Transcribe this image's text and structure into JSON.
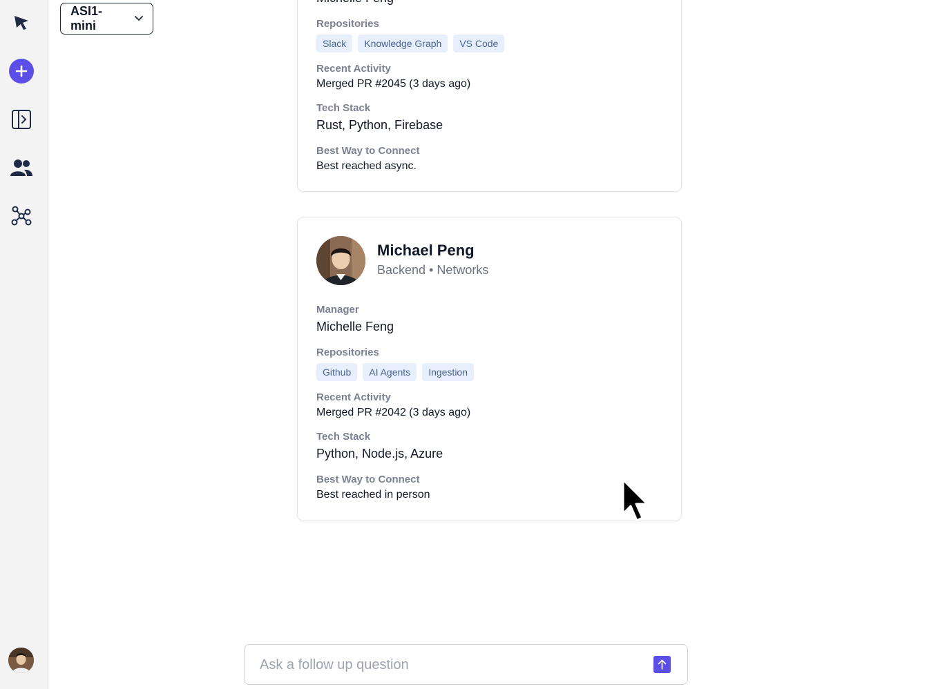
{
  "sidebar": {
    "icons": [
      "logo-arrow-icon",
      "new-chat-icon",
      "toggle-panel-icon",
      "people-icon",
      "graph-icon"
    ],
    "accent": "#5b4fe8"
  },
  "model_selector": {
    "label": "ASI1-mini"
  },
  "cards": {
    "top": {
      "manager_name_cut": "Michelle Feng",
      "repositories_label": "Repositories",
      "repositories": [
        "Slack",
        "Knowledge Graph",
        "VS Code"
      ],
      "recent_activity_label": "Recent Activity",
      "recent_activity": "Merged PR #2045 (3 days ago)",
      "tech_stack_label": "Tech Stack",
      "tech_stack": "Rust, Python, Firebase",
      "connect_label": "Best Way to Connect",
      "connect": "Best reached async."
    },
    "bottom": {
      "name": "Michael Peng",
      "role": "Backend • Networks",
      "manager_label": "Manager",
      "manager": "Michelle Feng",
      "repositories_label": "Repositories",
      "repositories": [
        "Github",
        "AI Agents",
        "Ingestion"
      ],
      "recent_activity_label": "Recent Activity",
      "recent_activity": "Merged PR #2042 (3 days ago)",
      "tech_stack_label": "Tech Stack",
      "tech_stack": "Python, Node.js, Azure",
      "connect_label": "Best Way to Connect",
      "connect": "Best reached in person"
    }
  },
  "ask": {
    "placeholder": "Ask a follow up question",
    "value": ""
  }
}
